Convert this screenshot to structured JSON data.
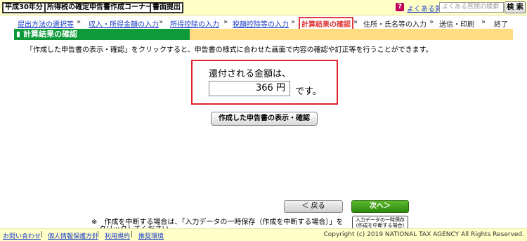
{
  "header": {
    "tabs": [
      "平成30年分",
      "所得税の確定申告書作成コーナー",
      "書面提出"
    ],
    "help_icon": "?",
    "faq_label": "よくある質問",
    "search_placeholder": "よくある質問の検索",
    "search_button": "検 索"
  },
  "steps": {
    "items": [
      {
        "label": "提出方法の選択等",
        "state": "done"
      },
      {
        "label": "収入・所得金額の入力",
        "state": "done"
      },
      {
        "label": "所得控除の入力",
        "state": "done"
      },
      {
        "label": "税額控除等の入力",
        "state": "done"
      },
      {
        "label": "計算結果の確認",
        "state": "current"
      },
      {
        "label": "住所・氏名等の入力",
        "state": "todo"
      },
      {
        "label": "送信・印刷",
        "state": "todo"
      },
      {
        "label": "終了",
        "state": "todo"
      }
    ],
    "separator": "»"
  },
  "page": {
    "title": "計算結果の確認",
    "description": "「作成した申告書の表示・確認」をクリックすると、申告書の様式に合わせた画面で内容の確認や訂正等を行うことができます。"
  },
  "refund": {
    "label": "還付される金額は、",
    "amount": "366",
    "unit": "円",
    "suffix": "です。"
  },
  "buttons": {
    "view": "作成した申告書の表示・確認",
    "back": "＜ 戻る",
    "next": "次へ＞",
    "save_line1": "入力データの一時保存",
    "save_line2": "(作成を中断する場合)"
  },
  "note": {
    "line1": "※　作成を中断する場合は、「入力データの一時保存（作成を中断する場合）」を",
    "line2": "クリックしてください。"
  },
  "footer": {
    "links": [
      "お問い合わせ",
      "個人情報保護方針",
      "利用規約",
      "推奨環境"
    ],
    "separator": "|",
    "copyright": "Copyright (c) 2019 NATIONAL TAX AGENCY All Rights Reserved."
  },
  "colors": {
    "header_bg": "#ffffc6",
    "title_green": "#0f9a3a",
    "title_band": "#ffdc82",
    "highlight_red": "#e0242c",
    "link_blue": "#1a3cc8"
  }
}
